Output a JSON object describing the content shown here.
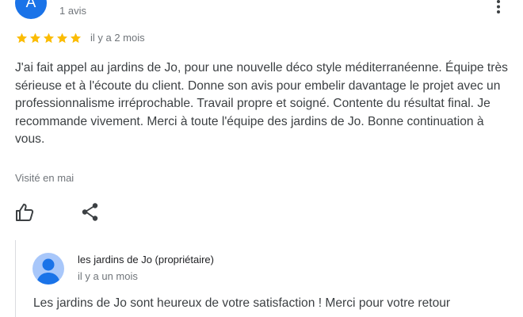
{
  "review": {
    "avatar_letter": "A",
    "review_count": "1 avis",
    "rating": 5,
    "rating_max": 5,
    "time_ago": "il y a 2 mois",
    "text": "J'ai fait appel au jardins de Jo, pour une nouvelle déco style méditerranéenne. Équipe très sérieuse et à l'écoute du client. Donne son avis pour embelir davantage le projet avec un professionnalisme irréprochable. Travail propre et soigné. Contente du résultat final. Je recommande vivement. Merci à toute l'équipe des jardins de Jo. Bonne continuation à vous.",
    "visited": "Visité en mai",
    "more_icon": "more-vert-icon",
    "like_icon": "thumb-up-icon",
    "share_icon": "share-icon",
    "avatar_color": "#1a73e8",
    "star_color": "#fbbc04"
  },
  "owner_reply": {
    "name": "les jardins de Jo (propriétaire)",
    "time_ago": "il y a un mois",
    "text": "Les jardins de Jo sont heureux de votre satisfaction ! Merci pour votre retour",
    "avatar_icon": "person-icon",
    "avatar_color": "#a8c7fa"
  }
}
